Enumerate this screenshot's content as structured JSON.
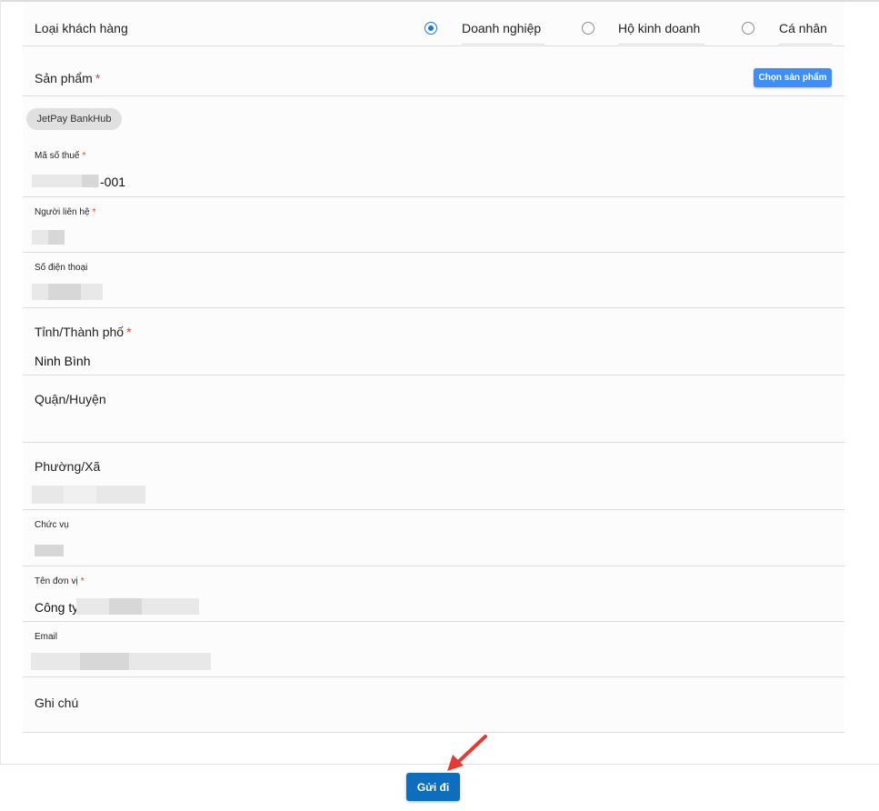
{
  "customer_type": {
    "label": "Loại khách hàng",
    "options": [
      {
        "label": "Doanh nghiệp",
        "checked": true
      },
      {
        "label": "Hộ kinh doanh",
        "checked": false
      },
      {
        "label": "Cá nhân",
        "checked": false
      }
    ]
  },
  "product": {
    "label": "Sản phẩm",
    "required_mark": "*",
    "choose_button": "Chọn sản phẩm",
    "selected_chip": "JetPay BankHub"
  },
  "fields": {
    "tax_code": {
      "label": "Mã số thuế",
      "required_mark": "*",
      "value_suffix": "-001"
    },
    "contact_person": {
      "label": "Người liên hệ",
      "required_mark": "*"
    },
    "phone": {
      "label": "Số điện thoại"
    },
    "province": {
      "label": "Tỉnh/Thành phố",
      "required_mark": "*",
      "value": "Ninh Bình"
    },
    "district": {
      "label": "Quận/Huyện",
      "value": ""
    },
    "ward": {
      "label": "Phường/Xã"
    },
    "position": {
      "label": "Chức vụ"
    },
    "unit_name": {
      "label": "Tên đơn vị",
      "required_mark": "*",
      "value_prefix": "Công ty"
    },
    "email": {
      "label": "Email"
    },
    "note": {
      "label": "Ghi chú",
      "value": ""
    }
  },
  "footer": {
    "submit_label": "Gửi đi"
  },
  "colors": {
    "primary_button": "#0d6ebe",
    "choose_button": "#3d8ef8",
    "radio_checked": "#1a73e8",
    "required": "#e53935",
    "arrow": "#e53935"
  }
}
